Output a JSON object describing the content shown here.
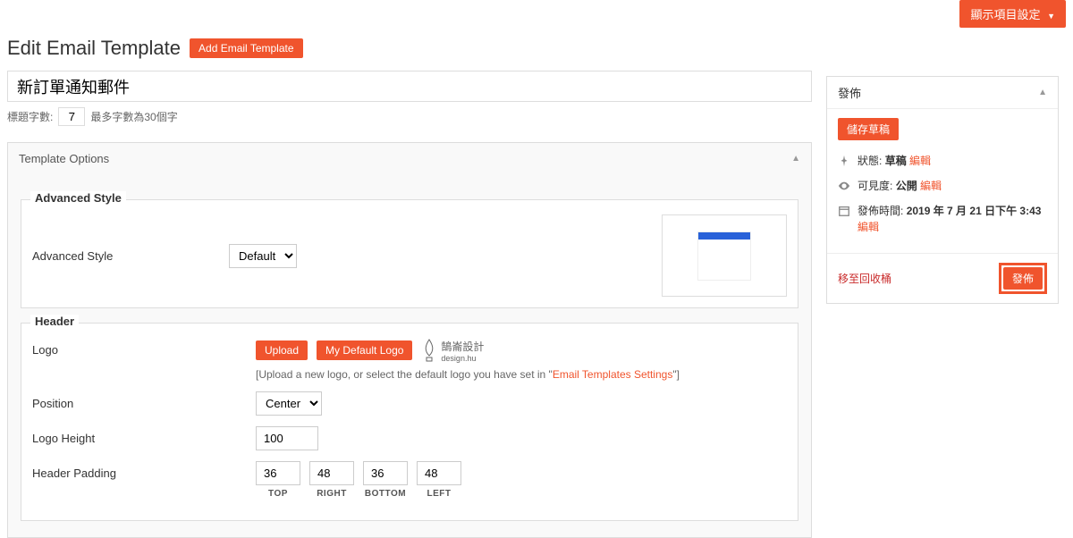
{
  "topButton": "顯示項目設定",
  "pageTitle": "Edit Email Template",
  "addBtn": "Add Email Template",
  "titleValue": "新訂單通知郵件",
  "charCountLabel": "標題字數:",
  "charCount": "7",
  "charMax": "最多字數為30個字",
  "optionsTitle": "Template Options",
  "advStyle": {
    "legend": "Advanced Style",
    "label": "Advanced Style",
    "value": "Default"
  },
  "header": {
    "legend": "Header",
    "logoLabel": "Logo",
    "uploadBtn": "Upload",
    "defaultLogoBtn": "My Default Logo",
    "hint1": "[Upload a new logo, or select the default logo you have set in \"",
    "hintLink": "Email Templates Settings",
    "hint2": "\"]",
    "logoText": "鵠崙設計",
    "logoSub": "design.hu",
    "positionLabel": "Position",
    "positionValue": "Center",
    "heightLabel": "Logo Height",
    "heightValue": "100",
    "paddingLabel": "Header Padding",
    "pad": {
      "top": "36",
      "right": "48",
      "bottom": "36",
      "left": "48"
    },
    "padLabels": {
      "top": "TOP",
      "right": "RIGHT",
      "bottom": "BOTTOM",
      "left": "LEFT"
    }
  },
  "publish": {
    "title": "發佈",
    "saveDraft": "儲存草稿",
    "statusLabel": "狀態:",
    "statusValue": "草稿",
    "edit": "編輯",
    "visLabel": "可見度:",
    "visValue": "公開",
    "timeLabel": "發佈時間:",
    "timeValue": "2019 年 7 月 21 日下午 3:43",
    "trash": "移至回收桶",
    "publishBtn": "發佈"
  }
}
